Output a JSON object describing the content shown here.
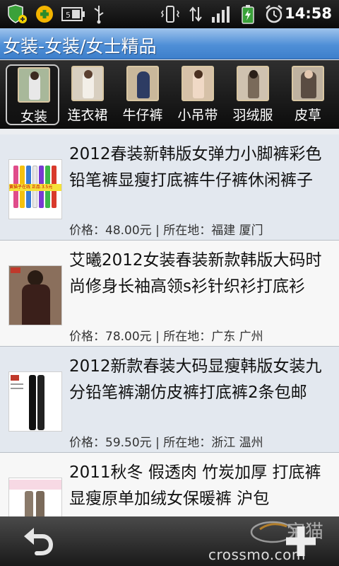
{
  "status_bar": {
    "time": "14:58",
    "icons": [
      "shield-plus-icon",
      "green-plus-icon",
      "battery-full-icon",
      "usb-icon",
      "vibrate-icon",
      "data-transfer-icon",
      "signal-icon",
      "battery-charging-icon",
      "alarm-icon"
    ]
  },
  "header": {
    "title": "女装-女装/女士精品"
  },
  "categories": [
    {
      "label": "女装",
      "selected": true
    },
    {
      "label": "连衣裙",
      "selected": false
    },
    {
      "label": "牛仔裤",
      "selected": false
    },
    {
      "label": "小吊带",
      "selected": false
    },
    {
      "label": "羽绒服",
      "selected": false
    },
    {
      "label": "皮草",
      "selected": false
    }
  ],
  "products": [
    {
      "name": "2012春装新韩版女弹力小脚裤彩色铅笔裤显瘦打底裤牛仔裤休闲裤子",
      "meta": "价格：48.00元 | 所在地：福建 厦门",
      "thumb_text": "黄猫子在线 正品 3.5元"
    },
    {
      "name": "艾曦2012女装春装新款韩版大码时尚修身长袖高领s衫针织衫打底衫",
      "meta": "价格：78.00元 | 所在地：广东 广州",
      "thumb_text": ""
    },
    {
      "name": "2012新款春装大码显瘦韩版女装九分铅笔裤潮仿皮裤打底裤2条包邮",
      "meta": "价格：59.50元 | 所在地：浙江 温州",
      "thumb_text": ""
    },
    {
      "name": "2011秋冬 假透肉 竹炭加厚 打底裤 显瘦原单加绒女保暖裤 沪包",
      "meta": "",
      "thumb_text": ""
    }
  ],
  "bottom_bar": {
    "watermark": "crossmo.com",
    "watermark_logo_text": "宇猫",
    "back_icon": "back-arrow-icon",
    "add_icon": "plus-icon"
  },
  "colors": {
    "title_bar": "#4f8fd7",
    "row_odd": "#e3e8ef",
    "row_even": "#f7f7f7"
  }
}
